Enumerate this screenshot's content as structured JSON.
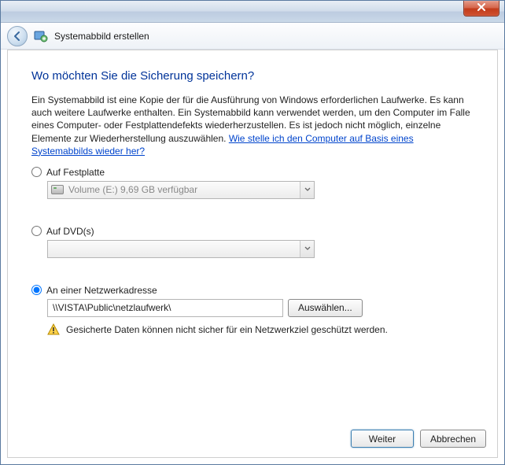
{
  "window": {
    "close_label": "X"
  },
  "header": {
    "title": "Systemabbild erstellen"
  },
  "main": {
    "heading": "Wo möchten Sie die Sicherung speichern?",
    "description": "Ein Systemabbild ist eine Kopie der für die Ausführung von Windows erforderlichen Laufwerke. Es kann auch weitere Laufwerke enthalten. Ein Systemabbild kann verwendet werden, um den Computer im Falle eines Computer- oder Festplattendefekts wiederherzustellen. Es ist jedoch nicht möglich, einzelne Elemente zur Wiederherstellung auszuwählen. ",
    "help_link": "Wie stelle ich den Computer auf Basis eines Systemabbilds wieder her?"
  },
  "options": {
    "hdd": {
      "label": "Auf Festplatte",
      "selected_value": "Volume (E:)  9,69 GB verfügbar",
      "checked": false
    },
    "dvd": {
      "label": "Auf DVD(s)",
      "selected_value": "",
      "checked": false
    },
    "network": {
      "label": "An einer Netzwerkadresse",
      "path": "\\\\VISTA\\Public\\netzlaufwerk\\",
      "browse_label": "Auswählen...",
      "warning": "Gesicherte Daten können nicht sicher für ein Netzwerkziel geschützt werden.",
      "checked": true
    }
  },
  "footer": {
    "next": "Weiter",
    "cancel": "Abbrechen"
  }
}
